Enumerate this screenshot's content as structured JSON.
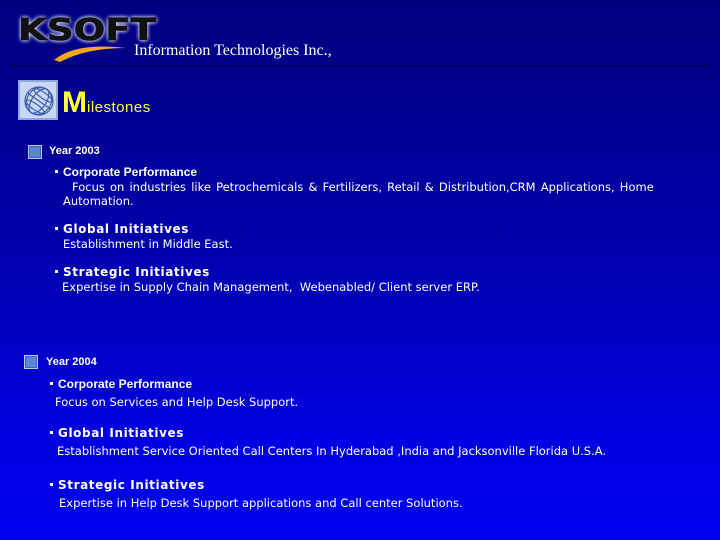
{
  "header": {
    "logo_text": "KSOFT",
    "company_name": "Information Technologies Inc.,"
  },
  "page": {
    "title_initial": "M",
    "title_rest": "ilestones",
    "title_icon": "globe-icon"
  },
  "colors": {
    "background_top": "#000080",
    "background_bottom": "#0000f2",
    "title": "#ffff33",
    "text": "#ffffff",
    "logo_swoosh": "#f5a623"
  },
  "years": [
    {
      "label": "Year 2003",
      "items": [
        {
          "heading": "Corporate Performance",
          "body": "Focus on industries like Petrochemicals & Fertilizers, Retail & Distribution,CRM Applications, Home",
          "body_cont": "Automation."
        },
        {
          "heading": "Global Initiatives",
          "body": "Establishment in Middle East."
        },
        {
          "heading": "Strategic Initiatives",
          "body": "Expertise in Supply Chain Management,  Webenabled/ Client server ERP."
        }
      ]
    },
    {
      "label": "Year 2004",
      "items": [
        {
          "heading": "Corporate Performance",
          "body": "Focus on Services and Help Desk Support."
        },
        {
          "heading": "Global Initiatives",
          "body": "Establishment Service Oriented Call Centers In Hyderabad ,India and Jacksonville Florida U.S.A."
        },
        {
          "heading": "Strategic Initiatives",
          "body": "Expertise in Help Desk Support applications and Call center Solutions."
        }
      ]
    }
  ]
}
